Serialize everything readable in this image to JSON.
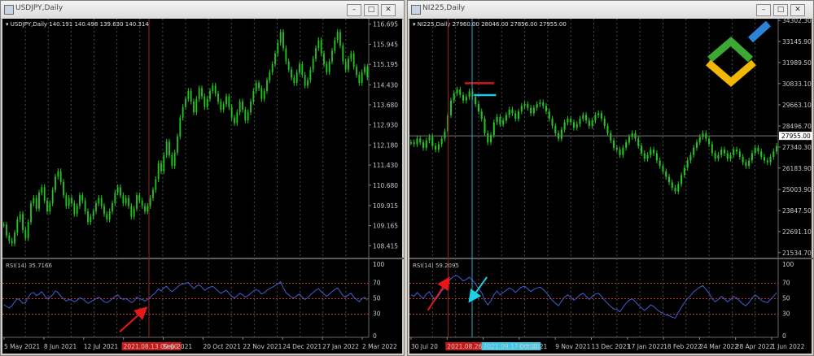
{
  "colors": {
    "candle": "#22c521",
    "rsi_line": "#3f5fd7",
    "level_line": "#c0392b",
    "grid": "#4a4a4a",
    "axis_text": "#c8c8c8",
    "vline_red": "#8b2a2a",
    "vline_cyan": "#2aa6c8",
    "arrow_red": "#e81818",
    "arrow_cyan": "#1ecfe8",
    "hline_red": "#d21414",
    "hline_cyan": "#1ec8e0",
    "date_highlight_red": "#c81818",
    "date_highlight_cyan": "#3cc8e6",
    "logo_green": "#3aaa35",
    "logo_yellow": "#f2b705",
    "logo_blue": "#2c84d6",
    "price_tag_bg": "#ffffff"
  },
  "windows": [
    {
      "id": "left",
      "title": "USDJPY,Daily",
      "info": "▾ USDJPY,Daily  140.191 140.498 139.630 140.314",
      "price_levels": [
        "116.695",
        "115.945",
        "115.195",
        "114.430",
        "113.680",
        "112.930",
        "112.180",
        "111.430",
        "110.680",
        "109.915",
        "109.165",
        "108.415"
      ],
      "price_range": [
        108.0,
        116.9
      ],
      "rsi_label": "RSI(14) 35.7166",
      "rsi_levels": [
        "100",
        "70",
        "50",
        "30",
        "0"
      ],
      "dates": [
        "5 May 2021",
        "8 Jun 2021",
        "12 Jul 2021",
        "2021.08.13 00:00",
        "Sep 2021",
        "20 Oct 2021",
        "22 Nov 2021",
        "24 Dec 2021",
        "27 Jan 2022",
        "2 Mar 2022"
      ],
      "highlight_date": "2021.08.13 00:00",
      "price_path": [
        109.2,
        108.8,
        108.6,
        108.5,
        108.9,
        109.4,
        109.6,
        109.0,
        108.7,
        109.3,
        110.0,
        110.2,
        109.8,
        110.4,
        110.6,
        110.1,
        109.7,
        110.0,
        110.5,
        111.0,
        111.2,
        110.8,
        110.3,
        109.9,
        110.2,
        110.0,
        109.6,
        109.9,
        110.3,
        110.1,
        109.7,
        109.3,
        109.5,
        109.7,
        110.0,
        110.2,
        109.9,
        109.6,
        109.4,
        109.7,
        110.0,
        110.4,
        110.6,
        110.3,
        110.0,
        110.2,
        109.9,
        109.5,
        109.8,
        110.3,
        110.1,
        109.9,
        109.7,
        109.9,
        110.2,
        110.5,
        110.9,
        111.5,
        111.2,
        111.8,
        112.3,
        111.8,
        111.4,
        111.9,
        112.5,
        113.2,
        113.6,
        113.9,
        114.2,
        113.8,
        113.4,
        113.9,
        114.3,
        114.0,
        113.6,
        113.9,
        114.2,
        114.4,
        114.1,
        113.8,
        113.5,
        113.7,
        114.0,
        113.6,
        113.2,
        113.0,
        113.4,
        113.8,
        113.5,
        113.1,
        113.4,
        113.8,
        114.2,
        114.5,
        114.3,
        113.9,
        114.2,
        114.6,
        114.9,
        115.2,
        115.6,
        116.0,
        116.4,
        115.8,
        115.3,
        115.0,
        114.7,
        114.5,
        114.9,
        115.2,
        114.8,
        114.4,
        114.6,
        115.0,
        115.4,
        115.8,
        116.1,
        115.6,
        115.2,
        114.9,
        115.3,
        115.7,
        116.1,
        116.4,
        115.9,
        115.3,
        115.0,
        115.4,
        115.6,
        115.1,
        114.8,
        114.5,
        114.9,
        115.1,
        114.7
      ],
      "rsi_path": [
        42,
        40,
        38,
        41,
        46,
        50,
        48,
        44,
        45,
        52,
        57,
        58,
        54,
        56,
        59,
        54,
        50,
        52,
        55,
        60,
        58,
        53,
        50,
        47,
        49,
        48,
        46,
        48,
        51,
        50,
        47,
        44,
        46,
        48,
        50,
        52,
        49,
        46,
        45,
        47,
        50,
        53,
        55,
        51,
        49,
        50,
        48,
        45,
        47,
        52,
        50,
        49,
        47,
        49,
        52,
        55,
        58,
        63,
        60,
        64,
        66,
        62,
        59,
        62,
        65,
        68,
        69,
        70,
        71,
        67,
        63,
        66,
        68,
        65,
        61,
        63,
        65,
        66,
        63,
        60,
        57,
        59,
        61,
        57,
        53,
        51,
        54,
        57,
        55,
        52,
        54,
        57,
        60,
        62,
        60,
        56,
        58,
        61,
        63,
        65,
        67,
        69,
        72,
        64,
        58,
        55,
        52,
        51,
        54,
        56,
        52,
        49,
        51,
        55,
        58,
        61,
        63,
        59,
        56,
        53,
        56,
        59,
        62,
        64,
        59,
        54,
        52,
        55,
        57,
        52,
        49,
        46,
        50,
        52,
        48
      ],
      "red_vline_frac": 0.4,
      "arrows": [
        {
          "color": "red",
          "from": [
            0.32,
            0.93
          ],
          "to": [
            0.39,
            0.63
          ]
        }
      ]
    },
    {
      "id": "right",
      "title": "NI225,Daily",
      "info": "▾ NI225,Daily  27960.00 28046.00 27856.00 27955.00",
      "price_levels": [
        "34302.30",
        "33145.90",
        "31989.50",
        "30833.10",
        "29663.10",
        "28496.70",
        "27340.30",
        "26183.90",
        "25003.90",
        "23847.50",
        "22691.10",
        "21534.70"
      ],
      "price_range": [
        21300,
        34400
      ],
      "current_price_tag": "27955.00",
      "rsi_label": "RSI(14) 59.2095",
      "rsi_levels": [
        "100",
        "70",
        "50",
        "30",
        "0"
      ],
      "dates": [
        "30 Jul 20",
        "2021.08.26",
        "2021.09.17 00:00",
        "Oct 2021",
        "9 Nov 2021",
        "13 Dec 2021",
        "17 Jan 2022",
        "18 Feb 2022",
        "24 Mar 2022",
        "28 Apr 2022",
        "1 Jun 2022"
      ],
      "highlight_dates": [
        "2021.08.26",
        "2021.09.17 00:00"
      ],
      "price_path": [
        27600,
        27500,
        27800,
        27600,
        27300,
        27700,
        27900,
        27400,
        27200,
        27500,
        27800,
        28200,
        29100,
        29900,
        30300,
        30500,
        30200,
        29900,
        30100,
        30400,
        30100,
        29700,
        29300,
        28900,
        28100,
        27600,
        28000,
        28700,
        29000,
        28600,
        28800,
        29100,
        29400,
        29200,
        28900,
        29300,
        29600,
        29700,
        29500,
        29200,
        29500,
        29700,
        29800,
        29600,
        29300,
        28900,
        28500,
        28100,
        27800,
        28300,
        28700,
        28900,
        28700,
        28400,
        28600,
        28900,
        29100,
        28800,
        28500,
        28800,
        29100,
        29200,
        28900,
        28500,
        28100,
        27700,
        27300,
        27200,
        26900,
        27300,
        27600,
        27900,
        28100,
        27800,
        27400,
        27000,
        26700,
        26900,
        27200,
        27000,
        26600,
        26300,
        26000,
        25700,
        25400,
        25100,
        24900,
        25300,
        25800,
        26200,
        26600,
        26900,
        27300,
        27600,
        27900,
        28100,
        27800,
        27500,
        27000,
        26700,
        26900,
        27200,
        27000,
        26700,
        26900,
        27200,
        27100,
        26800,
        26500,
        26300,
        26600,
        27000,
        27300,
        27100,
        26800,
        26600,
        26500,
        26800,
        27100,
        27400
      ],
      "rsi_path": [
        55,
        53,
        58,
        54,
        50,
        56,
        59,
        52,
        49,
        54,
        60,
        64,
        71,
        76,
        79,
        80,
        77,
        73,
        75,
        78,
        74,
        69,
        63,
        58,
        48,
        42,
        47,
        55,
        60,
        55,
        58,
        61,
        64,
        62,
        58,
        62,
        65,
        66,
        63,
        59,
        62,
        64,
        65,
        62,
        58,
        53,
        48,
        44,
        41,
        47,
        52,
        55,
        52,
        48,
        51,
        55,
        57,
        53,
        49,
        53,
        56,
        57,
        53,
        48,
        44,
        40,
        37,
        36,
        33,
        39,
        44,
        48,
        50,
        46,
        42,
        38,
        35,
        38,
        42,
        40,
        36,
        33,
        31,
        29,
        28,
        26,
        25,
        32,
        39,
        45,
        50,
        54,
        59,
        62,
        65,
        67,
        62,
        57,
        50,
        46,
        49,
        53,
        50,
        46,
        49,
        53,
        51,
        47,
        43,
        41,
        45,
        51,
        55,
        52,
        48,
        46,
        45,
        49,
        53,
        58
      ],
      "red_vline_frac": 0.105,
      "cyan_vline_frac": 0.17,
      "hlines": [
        {
          "color": "red",
          "value": 30850,
          "x_from": 0.15,
          "x_to": 0.23
        },
        {
          "color": "cyan",
          "value": 30200,
          "x_from": 0.175,
          "x_to": 0.235
        }
      ],
      "arrows": [
        {
          "color": "red",
          "from": [
            0.05,
            0.65
          ],
          "to": [
            0.105,
            0.25
          ]
        },
        {
          "color": "cyan",
          "from": [
            0.21,
            0.22
          ],
          "to": [
            0.165,
            0.52
          ]
        }
      ]
    }
  ],
  "window_buttons": {
    "minimize": "–",
    "maximize": "□",
    "close": "✕"
  },
  "logo": {
    "name": "brand-logo"
  }
}
